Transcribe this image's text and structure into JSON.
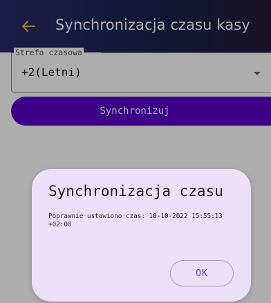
{
  "appbar": {
    "title": "Synchronizacja czasu kasy",
    "back_icon": "arrow-left-icon",
    "back_icon_color": "#e0b44a"
  },
  "timezone_field": {
    "label": "Strefa czasowa",
    "value": "+2(Letni)",
    "dropdown_icon": "triangle-down-icon"
  },
  "sync_button": {
    "label": "Synchronizuj",
    "color": "#5b00c9"
  },
  "dialog": {
    "title": "Synchronizacja czasu",
    "message": "Poprawnie ustawiono czas: 10-10-2022 15:55:13 +02:00",
    "ok_label": "OK",
    "background": "#ebdff9"
  }
}
